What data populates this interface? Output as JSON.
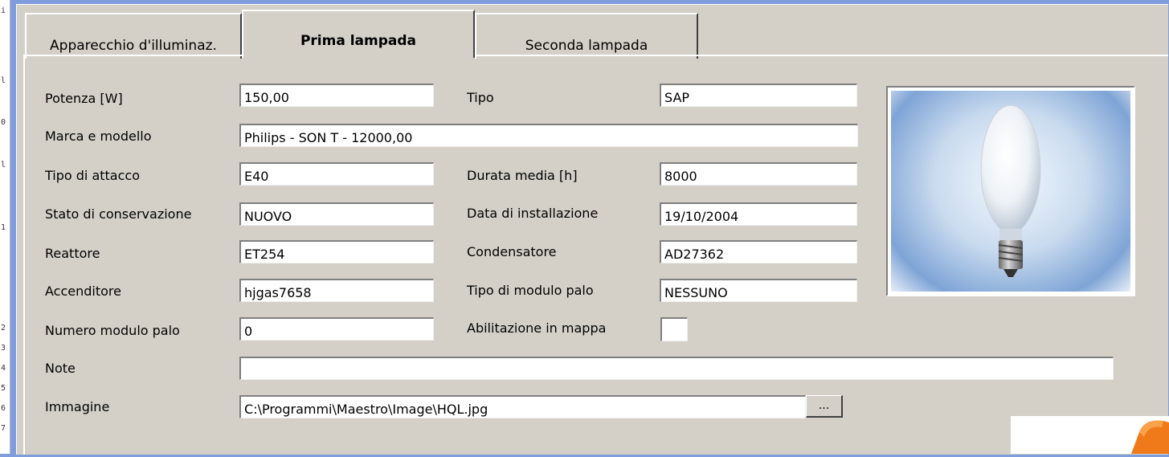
{
  "tabs": [
    {
      "label": "Apparecchio d'illuminaz.",
      "active": false
    },
    {
      "label": "Prima lampada",
      "active": true
    },
    {
      "label": "Seconda lampada",
      "active": false
    }
  ],
  "left_fields": {
    "potenza": {
      "label": "Potenza [W]",
      "value": "150,00"
    },
    "marca": {
      "label": "Marca e modello",
      "value": "Philips - SON T - 12000,00"
    },
    "attacco": {
      "label": "Tipo di attacco",
      "value": "E40"
    },
    "stato": {
      "label": "Stato di conservazione",
      "value": "NUOVO"
    },
    "reattore": {
      "label": "Reattore",
      "value": "ET254"
    },
    "accenditore": {
      "label": "Accenditore",
      "value": "hjgas7658"
    },
    "numero_modulo": {
      "label": "Numero modulo palo",
      "value": "0"
    },
    "note": {
      "label": "Note",
      "value": ""
    },
    "immagine": {
      "label": "Immagine",
      "value": "C:\\Programmi\\Maestro\\Image\\HQL.jpg"
    }
  },
  "right_fields": {
    "tipo": {
      "label": "Tipo",
      "value": "SAP"
    },
    "durata": {
      "label": "Durata media [h]",
      "value": "8000"
    },
    "data": {
      "label": "Data di installazione",
      "value": "19/10/2004"
    },
    "condensatore": {
      "label": "Condensatore",
      "value": "AD27362"
    },
    "modulo_palo": {
      "label": "Tipo di modulo palo",
      "value": "NESSUNO"
    },
    "abilitazione": {
      "label": "Abilitazione in mappa",
      "checked": false
    }
  },
  "browse_label": "...",
  "left_strip_chars": [
    "i",
    "l",
    "0",
    "l",
    "1",
    "2",
    "3",
    "4",
    "5",
    "6",
    "7"
  ],
  "colors": {
    "window_bg": "#d4d0c8",
    "desktop_blue": "#7f9ddc",
    "lamp_bg": "#7ea4d6"
  },
  "icons": {
    "lamp_image": "hql-lamp-bulb",
    "logo": "orange-logo"
  }
}
